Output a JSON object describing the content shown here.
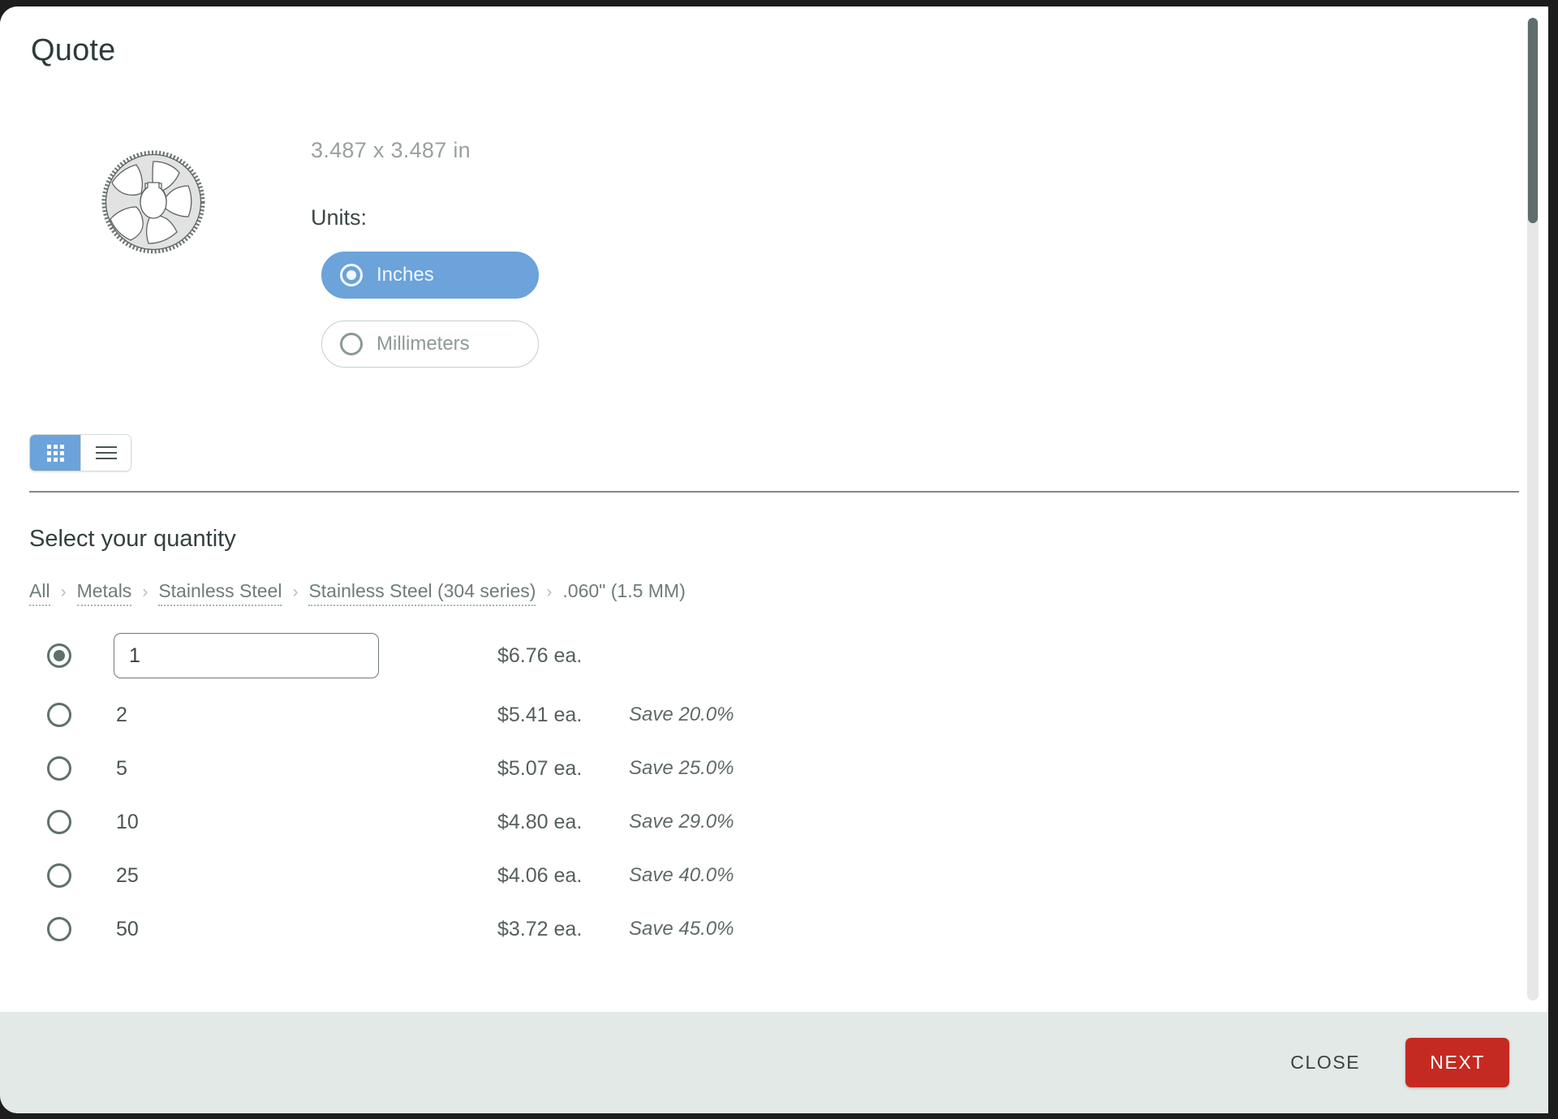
{
  "colors": {
    "accent_blue": "#6BA3DA",
    "primary_red": "#C42A21",
    "footer_bg": "#E3E9E7",
    "text_dark": "#2F3B3B",
    "text_muted": "#9AA0A0",
    "border_gray": "#6C7A77"
  },
  "header": {
    "title": "Quote"
  },
  "part": {
    "thumbnail_icon": "sprocket-gear-icon",
    "dimensions": "3.487 x 3.487 in",
    "units_label": "Units:",
    "unit_options": [
      {
        "label": "Inches",
        "selected": true
      },
      {
        "label": "Millimeters",
        "selected": false
      }
    ]
  },
  "view_toggle": {
    "options": [
      {
        "icon": "grid-view-icon",
        "active": true
      },
      {
        "icon": "list-view-icon",
        "active": false
      }
    ]
  },
  "quantity": {
    "heading": "Select your quantity",
    "breadcrumb": [
      {
        "label": "All",
        "current": false
      },
      {
        "label": "Metals",
        "current": false
      },
      {
        "label": "Stainless Steel",
        "current": false
      },
      {
        "label": "Stainless Steel (304 series)",
        "current": false
      },
      {
        "label": ".060\" (1.5 MM)",
        "current": true
      }
    ],
    "breadcrumb_separator": "›",
    "rows": [
      {
        "qty": "1",
        "is_input": true,
        "selected": true,
        "price": "$6.76 ea.",
        "save": ""
      },
      {
        "qty": "2",
        "is_input": false,
        "selected": false,
        "price": "$5.41 ea.",
        "save": "Save 20.0%"
      },
      {
        "qty": "5",
        "is_input": false,
        "selected": false,
        "price": "$5.07 ea.",
        "save": "Save 25.0%"
      },
      {
        "qty": "10",
        "is_input": false,
        "selected": false,
        "price": "$4.80 ea.",
        "save": "Save 29.0%"
      },
      {
        "qty": "25",
        "is_input": false,
        "selected": false,
        "price": "$4.06 ea.",
        "save": "Save 40.0%"
      },
      {
        "qty": "50",
        "is_input": false,
        "selected": false,
        "price": "$3.72 ea.",
        "save": "Save 45.0%"
      }
    ]
  },
  "footer": {
    "close_label": "CLOSE",
    "next_label": "NEXT"
  }
}
